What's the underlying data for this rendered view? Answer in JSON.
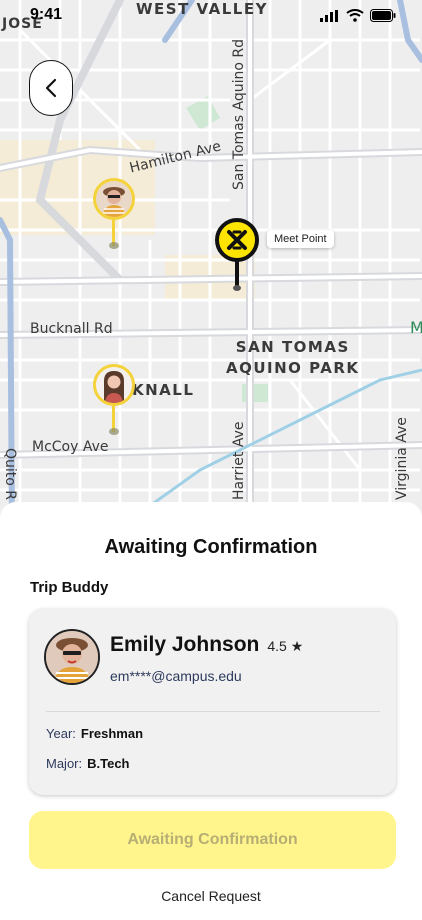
{
  "status_bar": {
    "time": "9:41"
  },
  "map": {
    "labels": {
      "west_valley": "WEST VALLEY",
      "jose": "JOSE",
      "hamilton": "Hamilton Ave",
      "san_tomas_road": "San Tomas Aquino Rd",
      "bucknall": "Bucknall Rd",
      "park": "SAN TOMAS\nAQUINO PARK",
      "knall": "KNALL",
      "mccoy": "McCoy Ave",
      "quito": "Quito R",
      "harriet": "Harriet Ave",
      "virginia": "Virginia Ave",
      "m": "M"
    },
    "meet_point_label": "Meet Point"
  },
  "sheet": {
    "title": "Awaiting Confirmation",
    "section_label": "Trip Buddy",
    "buddy": {
      "name": "Emily Johnson",
      "rating": "4.5 ★",
      "email": "em****@campus.edu",
      "year_label": "Year:",
      "year_value": "Freshman",
      "major_label": "Major:",
      "major_value": "B.Tech"
    },
    "primary_button": "Awaiting Confirmation",
    "cancel_link": "Cancel Request"
  },
  "colors": {
    "accent_yellow": "#ffe400",
    "button_yellow": "#fff58c",
    "map_bg": "#eeeeef",
    "road_blue": "#a9bfe0"
  }
}
